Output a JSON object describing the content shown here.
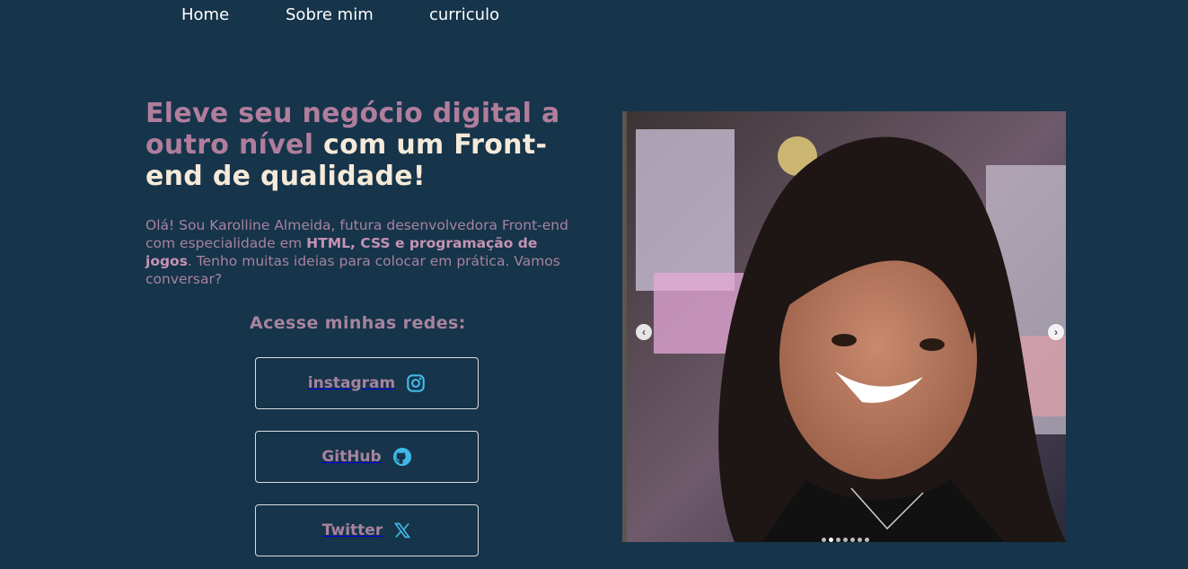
{
  "nav": {
    "items": [
      {
        "label": "Home"
      },
      {
        "label": "Sobre mim"
      },
      {
        "label": "curriculo"
      }
    ]
  },
  "hero": {
    "headline_part1": "Eleve seu negócio digital a outro nível",
    "headline_part2": "com um Front-end de qualidade!",
    "intro_start": "Olá! Sou Karolline Almeida, futura desenvolvedora Front-end com especialidade em ",
    "intro_bold": "HTML, CSS e programação de jogos",
    "intro_end": ". Tenho muitas ideias para colocar em prática. Vamos conversar?"
  },
  "social": {
    "title": "Acesse minhas redes:",
    "buttons": [
      {
        "label": "instagram",
        "icon": "instagram-icon"
      },
      {
        "label": "GitHub",
        "icon": "github-icon"
      },
      {
        "label": "Twitter",
        "icon": "x-icon"
      }
    ]
  },
  "carousel": {
    "prev_icon": "chevron-left-icon",
    "next_icon": "chevron-right-icon",
    "dot_count": 7,
    "active_dot": 1
  },
  "colors": {
    "background": "#16344a",
    "accent_pink": "#b07e9c",
    "cream": "#f5ead9",
    "icon_blue": "#3fb8e6"
  }
}
